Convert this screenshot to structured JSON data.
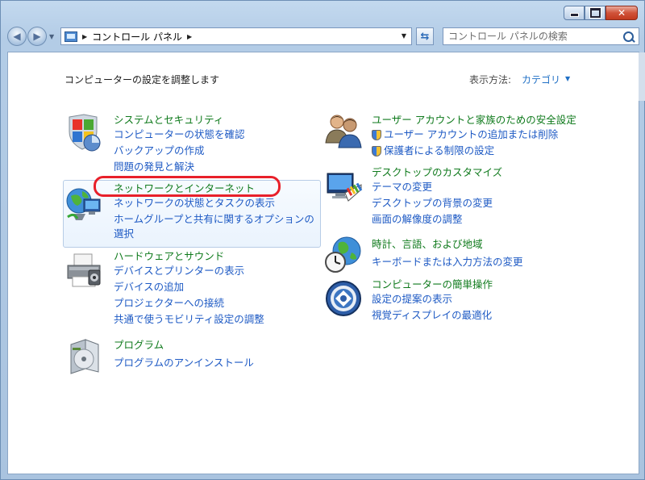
{
  "window": {
    "caption_buttons": {
      "minimize": "minimize",
      "maximize": "maximize",
      "close": "close"
    }
  },
  "nav": {
    "back_icon": "back-arrow-icon",
    "forward_icon": "forward-arrow-icon",
    "breadcrumb": [
      "コントロール パネル"
    ],
    "search_placeholder": "コントロール パネルの検索"
  },
  "content": {
    "heading": "コンピューターの設定を調整します",
    "view_by_label": "表示方法:",
    "view_by_value": "カテゴリ"
  },
  "categories_left": [
    {
      "icon": "shield-flag-icon",
      "title": "システムとセキュリティ",
      "links": [
        "コンピューターの状態を確認",
        "バックアップの作成",
        "問題の発見と解決"
      ]
    },
    {
      "icon": "network-globe-icon",
      "title": "ネットワークとインターネット",
      "links": [
        "ネットワークの状態とタスクの表示",
        "ホームグループと共有に関するオプションの",
        "選択"
      ]
    },
    {
      "icon": "printer-icon",
      "title": "ハードウェアとサウンド",
      "links": [
        "デバイスとプリンターの表示",
        "デバイスの追加",
        "プロジェクターへの接続",
        "共通で使うモビリティ設定の調整"
      ]
    },
    {
      "icon": "program-box-icon",
      "title": "プログラム",
      "links": [
        "プログラムのアンインストール"
      ]
    }
  ],
  "categories_right": [
    {
      "icon": "users-icon",
      "title": "ユーザー アカウントと家族のための安全設定",
      "links": [
        "ユーザー アカウントの追加または削除",
        "保護者による制限の設定"
      ]
    },
    {
      "icon": "desktop-palette-icon",
      "title": "デスクトップのカスタマイズ",
      "links": [
        "テーマの変更",
        "デスクトップの背景の変更",
        "画面の解像度の調整"
      ]
    },
    {
      "icon": "clock-globe-icon",
      "title": "時計、言語、および地域",
      "links": [
        "キーボードまたは入力方法の変更"
      ]
    },
    {
      "icon": "ease-of-access-icon",
      "title": "コンピューターの簡単操作",
      "links": [
        "設定の提案の表示",
        "視覚ディスプレイの最適化"
      ]
    }
  ],
  "colors": {
    "category_title": "#0f7a1c",
    "link": "#1e5ac4",
    "highlight_oval": "#e8202a"
  }
}
